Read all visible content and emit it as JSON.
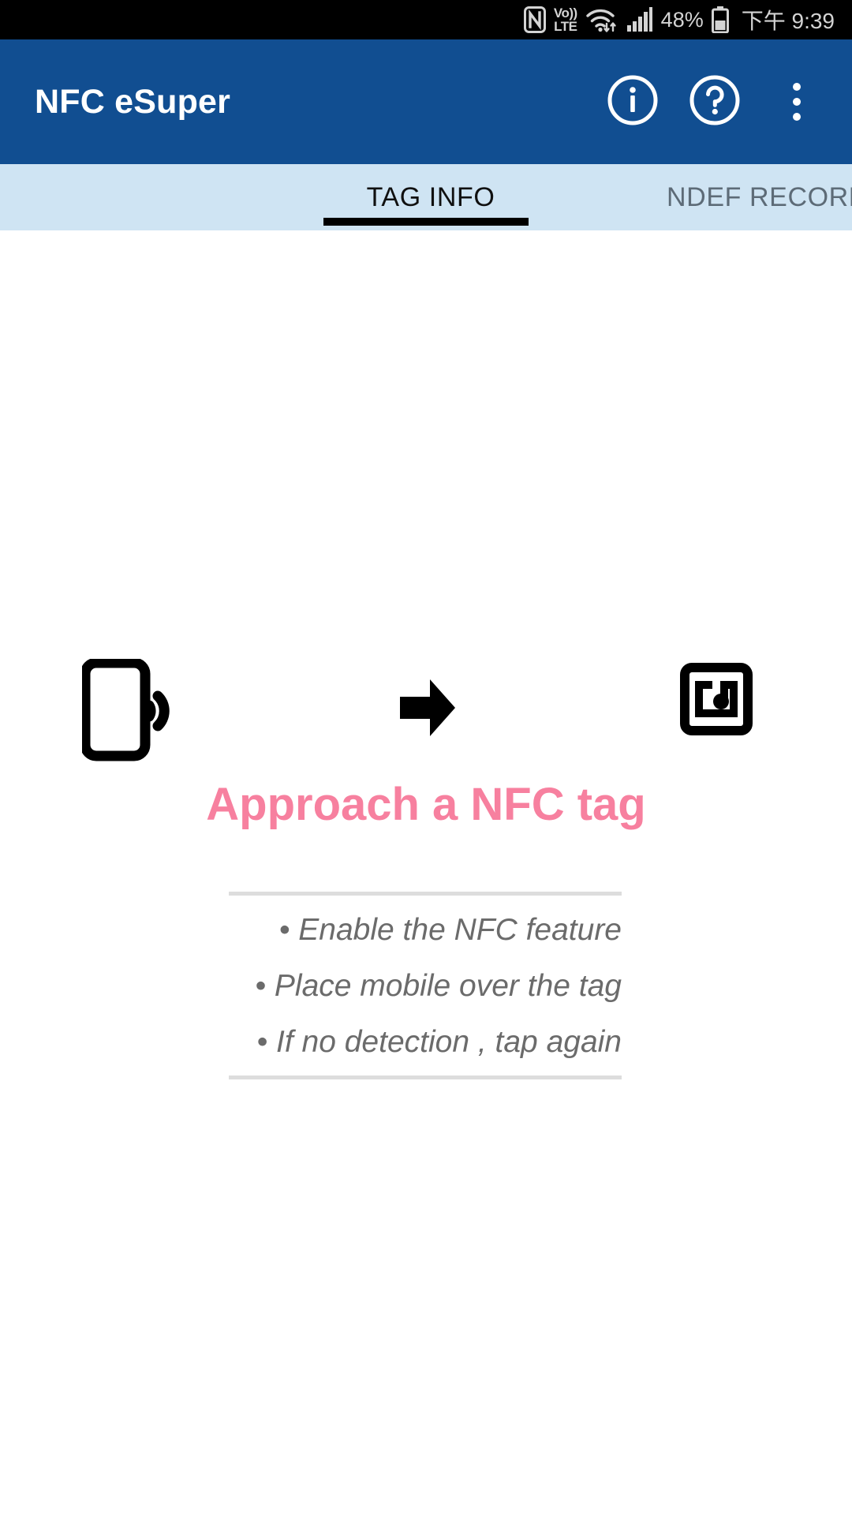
{
  "status_bar": {
    "icons": [
      "nfc-icon",
      "volte-icon",
      "wifi-icon",
      "cellular-signal-icon",
      "battery-icon"
    ],
    "volte_top": "Vo))",
    "volte_bottom": "LTE",
    "battery_percent": "48%",
    "clock": "下午 9:39"
  },
  "app_bar": {
    "title": "NFC eSuper",
    "actions": [
      {
        "name": "info-button",
        "icon": "info-circle-icon"
      },
      {
        "name": "help-button",
        "icon": "question-circle-icon"
      },
      {
        "name": "overflow-menu-button",
        "icon": "more-vertical-icon"
      }
    ]
  },
  "tabs": {
    "items": [
      {
        "label": "TAG INFO",
        "active": true
      },
      {
        "label": "NDEF RECORD",
        "active": false
      }
    ]
  },
  "main": {
    "illustration": {
      "source_icon": "phone-nfc-icon",
      "arrow_icon": "arrow-right-icon",
      "target_icon": "nfc-tag-icon"
    },
    "headline": "Approach a NFC tag",
    "hints": [
      "• Enable the NFC feature",
      "• Place mobile over the tag",
      "• If no detection , tap again"
    ]
  },
  "colors": {
    "app_bar": "#114E91",
    "tab_bar": "#CFE4F3",
    "headline": "#F7809F",
    "hint_text": "#6B6B6B",
    "status_bar": "#000000"
  }
}
